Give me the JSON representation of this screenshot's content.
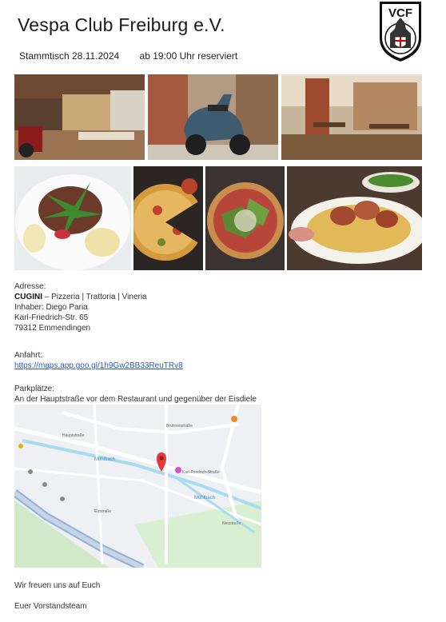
{
  "header": {
    "title": "Vespa Club Freiburg e.V.",
    "event": "Stammtisch 28.11.2024",
    "time": "ab 19:00 Uhr reserviert",
    "logo_text": "VCF"
  },
  "address": {
    "label": "Adresse:",
    "name": "CUGINI",
    "subtitle": "– Pizzeria | Trattoria | Vineria",
    "owner": "Inhaber: Diego Paria",
    "street": "Karl-Friedrich-Str. 65",
    "city": "79312 Emmendingen"
  },
  "route": {
    "label": "Anfahrt:",
    "link": "https://maps.app.goo.gl/1h9Gw2BB33ReuTRv8"
  },
  "parking": {
    "label": "Parkplätze:",
    "text": "An der Hauptstraße vor dem Restaurant und gegenüber der Eisdiele"
  },
  "map": {
    "labels": [
      "Mühlbach",
      "Mühlbach",
      "Karl-Friedrich-Straße",
      "Brunnenstraße",
      "Hauptstraße",
      "Neustraße",
      "Elzstraße"
    ]
  },
  "closing": {
    "line1": "Wir freuen uns auf Euch",
    "line2": "Euer Vorstandsteam"
  },
  "colors": {
    "link": "#2b55c9",
    "map_water": "#a6dcef",
    "map_land": "#eef0f3",
    "map_park": "#cfe9c9"
  }
}
